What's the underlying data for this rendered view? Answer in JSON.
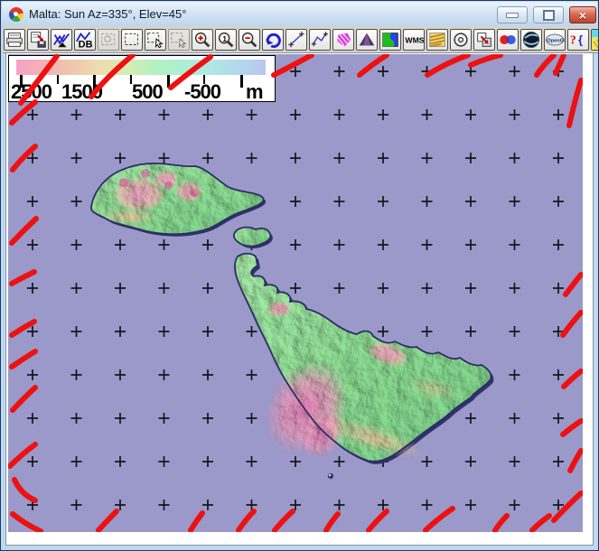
{
  "window": {
    "title": "Malta: Sun Az=335°, Elev=45°",
    "controls": {
      "minimize": "minimize",
      "restore": "restore",
      "close": "close"
    }
  },
  "toolbar": {
    "buttons": [
      {
        "name": "print",
        "icon": "print"
      },
      {
        "name": "save",
        "icon": "save"
      },
      {
        "name": "load-terrain",
        "icon": "load-terrain"
      },
      {
        "name": "terrain-db",
        "icon": "terrain-db",
        "text": "DB"
      },
      {
        "name": "select-region",
        "icon": "select-blob",
        "disabled": true
      },
      {
        "name": "select-box",
        "icon": "select-box"
      },
      {
        "name": "select-pointer",
        "icon": "select-pointer"
      },
      {
        "name": "select-pointer-alt",
        "icon": "select-pointer",
        "disabled": true
      },
      {
        "name": "zoom-in",
        "icon": "zoom-in"
      },
      {
        "name": "zoom-actual",
        "icon": "zoom-one",
        "text": "1"
      },
      {
        "name": "zoom-out",
        "icon": "zoom-out"
      },
      {
        "name": "redraw",
        "icon": "redraw"
      },
      {
        "name": "measure-line",
        "icon": "measure-line"
      },
      {
        "name": "measure-path",
        "icon": "measure-path"
      },
      {
        "name": "area-polygon",
        "icon": "area-polygon"
      },
      {
        "name": "view-3d",
        "icon": "view-3d"
      },
      {
        "name": "map-overlay",
        "icon": "map-overlay"
      },
      {
        "name": "wms",
        "icon": "wms",
        "text": "WMS"
      },
      {
        "name": "texture-overlay",
        "icon": "texture"
      },
      {
        "name": "gps-target",
        "icon": "gps-target"
      },
      {
        "name": "copy-region",
        "icon": "copy-region"
      },
      {
        "name": "anaglyph-3d",
        "icon": "anaglyph"
      },
      {
        "name": "google-earth",
        "icon": "google-earth"
      },
      {
        "name": "opengl",
        "icon": "opengl",
        "text": "OpenGL"
      },
      {
        "name": "help",
        "icon": "help",
        "text": "?{"
      },
      {
        "name": "color-relief",
        "icon": "color-relief",
        "partial": true
      }
    ]
  },
  "legend": {
    "labels": [
      "2500",
      "1500",
      "500",
      "-500"
    ],
    "unit": "m",
    "tick_count": 7,
    "gradient": [
      "#f6a2c6",
      "#f0c6ae",
      "#eedcae",
      "#b5efbe",
      "#abefd2",
      "#b3d9ec",
      "#b9c6ef"
    ]
  },
  "map": {
    "sea_color": "#9a99c9",
    "islands": [
      "Gozo",
      "Comino",
      "Malta",
      "Filfla"
    ],
    "graticule_mark": "+",
    "edge_marks_color": "#ee1111"
  }
}
